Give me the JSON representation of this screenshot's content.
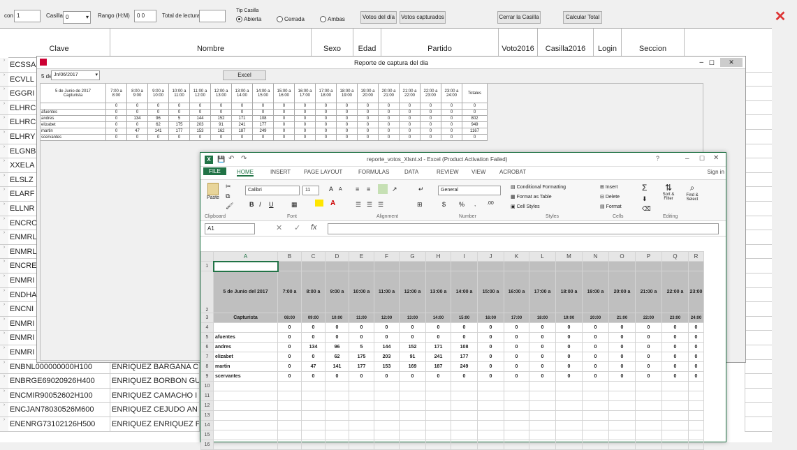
{
  "toolbar": {
    "field1_label": "con",
    "field1_value": "1",
    "casilla_label": "Casilla",
    "casilla_value": "0",
    "rango_label": "Rango (H:M)",
    "rango_value": "0  0",
    "total_label": "Total de lecturas",
    "total_value": "",
    "tipo_label": "Tip Casilla",
    "radio_abierta": "Abierta",
    "radio_cerrada": "Cerrada",
    "radio_ambas": "Ambas",
    "btn_votos_dia": "Votos del día",
    "btn_votos_capturados": "Votos capturados",
    "btn_cerrar_casilla": "Cerrar la Casilla",
    "btn_calcular_total": "Calcular Total"
  },
  "grid": {
    "headers": [
      "Clave",
      "Nombre",
      "Sexo",
      "Edad",
      "Partido",
      "Voto2016",
      "Casilla2016",
      "Login",
      "Seccion"
    ],
    "clave_partial": [
      "ECSSA",
      "ECVLL",
      "EGGRI",
      "ELHRC",
      "ELHRC",
      "ELHRY",
      "ELGNB",
      "XXELA",
      "ELSLZ",
      "ELARF",
      "ELLNR",
      "ENCRO",
      "ENMRL",
      "ENMRL",
      "ENCRE",
      "ENMRI",
      "ENDHA",
      "ENCNI",
      "ENMRI",
      "ENMRI",
      "ENMRI"
    ],
    "rows_full": [
      {
        "clave": "ENBNL000000000H100",
        "nombre": "ENRIQUEZ BARGANA C"
      },
      {
        "clave": "ENBRGE69020926H400",
        "nombre": "ENRIQUEZ BORBON GU"
      },
      {
        "clave": "ENCMIR90052602H100",
        "nombre": "ENRIQUEZ CAMACHO I"
      },
      {
        "clave": "ENCJAN78030526M600",
        "nombre": "ENRIQUEZ CEJUDO AN"
      },
      {
        "clave": "ENENRG73102126H500",
        "nombre": "ENRIQUEZ ENRIQUEZ F"
      }
    ]
  },
  "report": {
    "title": "Reporte de captura del dia",
    "date_label": "5 de",
    "date_value": "Jn/06/2017",
    "export_button": "Excel",
    "table": {
      "corner": [
        "5 de Junio de 2017",
        "Capturista"
      ],
      "columns": [
        "7:00 a 8:00",
        "8:00 a 9:00",
        "9:00 a 10:00",
        "10:00 a 11:00",
        "11:00 a 12:00",
        "12:00 a 13:00",
        "13:00 a 14:00",
        "14:00 a 15:00",
        "15:00 a 16:00",
        "16:00 a 17:00",
        "17:00 a 18:00",
        "18:00 a 19:00",
        "19:00 a 20:00",
        "20:00 a 21:00",
        "21:00 a 22:00",
        "22:00 a 23:00",
        "23:00 a 24:00",
        "Totales"
      ],
      "rows": [
        {
          "name": "",
          "values": [
            "0",
            "0",
            "0",
            "0",
            "0",
            "0",
            "0",
            "0",
            "0",
            "0",
            "0",
            "0",
            "0",
            "0",
            "0",
            "0",
            "0",
            "0"
          ]
        },
        {
          "name": "afuentes",
          "values": [
            "0",
            "0",
            "0",
            "0",
            "0",
            "0",
            "0",
            "0",
            "0",
            "0",
            "0",
            "0",
            "0",
            "0",
            "0",
            "0",
            "0",
            "0"
          ]
        },
        {
          "name": "andres",
          "values": [
            "0",
            "134",
            "96",
            "5",
            "144",
            "152",
            "171",
            "108",
            "0",
            "0",
            "0",
            "0",
            "0",
            "0",
            "0",
            "0",
            "0",
            "802"
          ]
        },
        {
          "name": "elizabet",
          "values": [
            "0",
            "0",
            "62",
            "175",
            "203",
            "91",
            "241",
            "177",
            "0",
            "0",
            "0",
            "0",
            "0",
            "0",
            "0",
            "0",
            "0",
            "949"
          ]
        },
        {
          "name": "martin",
          "values": [
            "0",
            "47",
            "141",
            "177",
            "153",
            "162",
            "187",
            "249",
            "0",
            "0",
            "0",
            "0",
            "0",
            "0",
            "0",
            "0",
            "0",
            "1167"
          ]
        },
        {
          "name": "scervantes",
          "values": [
            "0",
            "0",
            "0",
            "0",
            "0",
            "0",
            "0",
            "0",
            "0",
            "0",
            "0",
            "0",
            "0",
            "0",
            "0",
            "0",
            "0",
            "0"
          ]
        }
      ]
    }
  },
  "excel": {
    "title": "reporte_votos_Xlsnt.xl - Excel (Product Activation Failed)",
    "sign_in": "Sign in",
    "tabs": [
      "FILE",
      "HOME",
      "INSERT",
      "PAGE LAYOUT",
      "FORMULAS",
      "DATA",
      "REVIEW",
      "VIEW",
      "ACROBAT"
    ],
    "font_name": "Calibri",
    "font_size": "11",
    "number_format": "General",
    "name_box": "A1",
    "groups": [
      "Clipboard",
      "Font",
      "Alignment",
      "Number",
      "Styles",
      "Cells",
      "Editing"
    ],
    "styles": [
      "Conditional Formatting",
      "Format as Table",
      "Cell Styles"
    ],
    "cells_btns": [
      "Insert",
      "Delete",
      "Format"
    ],
    "editing_btns": [
      "Sort & Filter",
      "Find & Select"
    ],
    "paste": "Paste",
    "col_letters": [
      "A",
      "B",
      "C",
      "D",
      "E",
      "F",
      "G",
      "H",
      "I",
      "J",
      "K",
      "L",
      "M",
      "N",
      "O",
      "P",
      "Q",
      "R"
    ],
    "header_date": "5 de Junio del 2017",
    "header_capt": "Capturista",
    "hours_top": [
      "7:00 a",
      "8:00 a",
      "9:00 a",
      "10:00 a",
      "11:00 a",
      "12:00 a",
      "13:00 a",
      "14:00 a",
      "15:00 a",
      "16:00 a",
      "17:00 a",
      "18:00 a",
      "19:00 a",
      "20:00 a",
      "21:00 a",
      "22:00 a",
      "23:00"
    ],
    "hours_bottom": [
      "08:00",
      "09:00",
      "10:00",
      "11:00",
      "12:00",
      "13:00",
      "14:00",
      "15:00",
      "16:00",
      "17:00",
      "18:00",
      "19:00",
      "20:00",
      "21:00",
      "22:00",
      "23:00",
      "24:00"
    ],
    "data_rows": [
      {
        "name": "",
        "values": [
          "0",
          "0",
          "0",
          "0",
          "0",
          "0",
          "0",
          "0",
          "0",
          "0",
          "0",
          "0",
          "0",
          "0",
          "0",
          "0",
          "0"
        ]
      },
      {
        "name": "afuentes",
        "values": [
          "0",
          "0",
          "0",
          "0",
          "0",
          "0",
          "0",
          "0",
          "0",
          "0",
          "0",
          "0",
          "0",
          "0",
          "0",
          "0",
          "0"
        ]
      },
      {
        "name": "andres",
        "values": [
          "0",
          "134",
          "96",
          "5",
          "144",
          "152",
          "171",
          "108",
          "0",
          "0",
          "0",
          "0",
          "0",
          "0",
          "0",
          "0",
          "0"
        ]
      },
      {
        "name": "elizabet",
        "values": [
          "0",
          "0",
          "62",
          "175",
          "203",
          "91",
          "241",
          "177",
          "0",
          "0",
          "0",
          "0",
          "0",
          "0",
          "0",
          "0",
          "0"
        ]
      },
      {
        "name": "martin",
        "values": [
          "0",
          "47",
          "141",
          "177",
          "153",
          "169",
          "187",
          "249",
          "0",
          "0",
          "0",
          "0",
          "0",
          "0",
          "0",
          "0",
          "0"
        ]
      },
      {
        "name": "scervantes",
        "values": [
          "0",
          "0",
          "0",
          "0",
          "0",
          "0",
          "0",
          "0",
          "0",
          "0",
          "0",
          "0",
          "0",
          "0",
          "0",
          "0",
          "0"
        ]
      }
    ]
  }
}
